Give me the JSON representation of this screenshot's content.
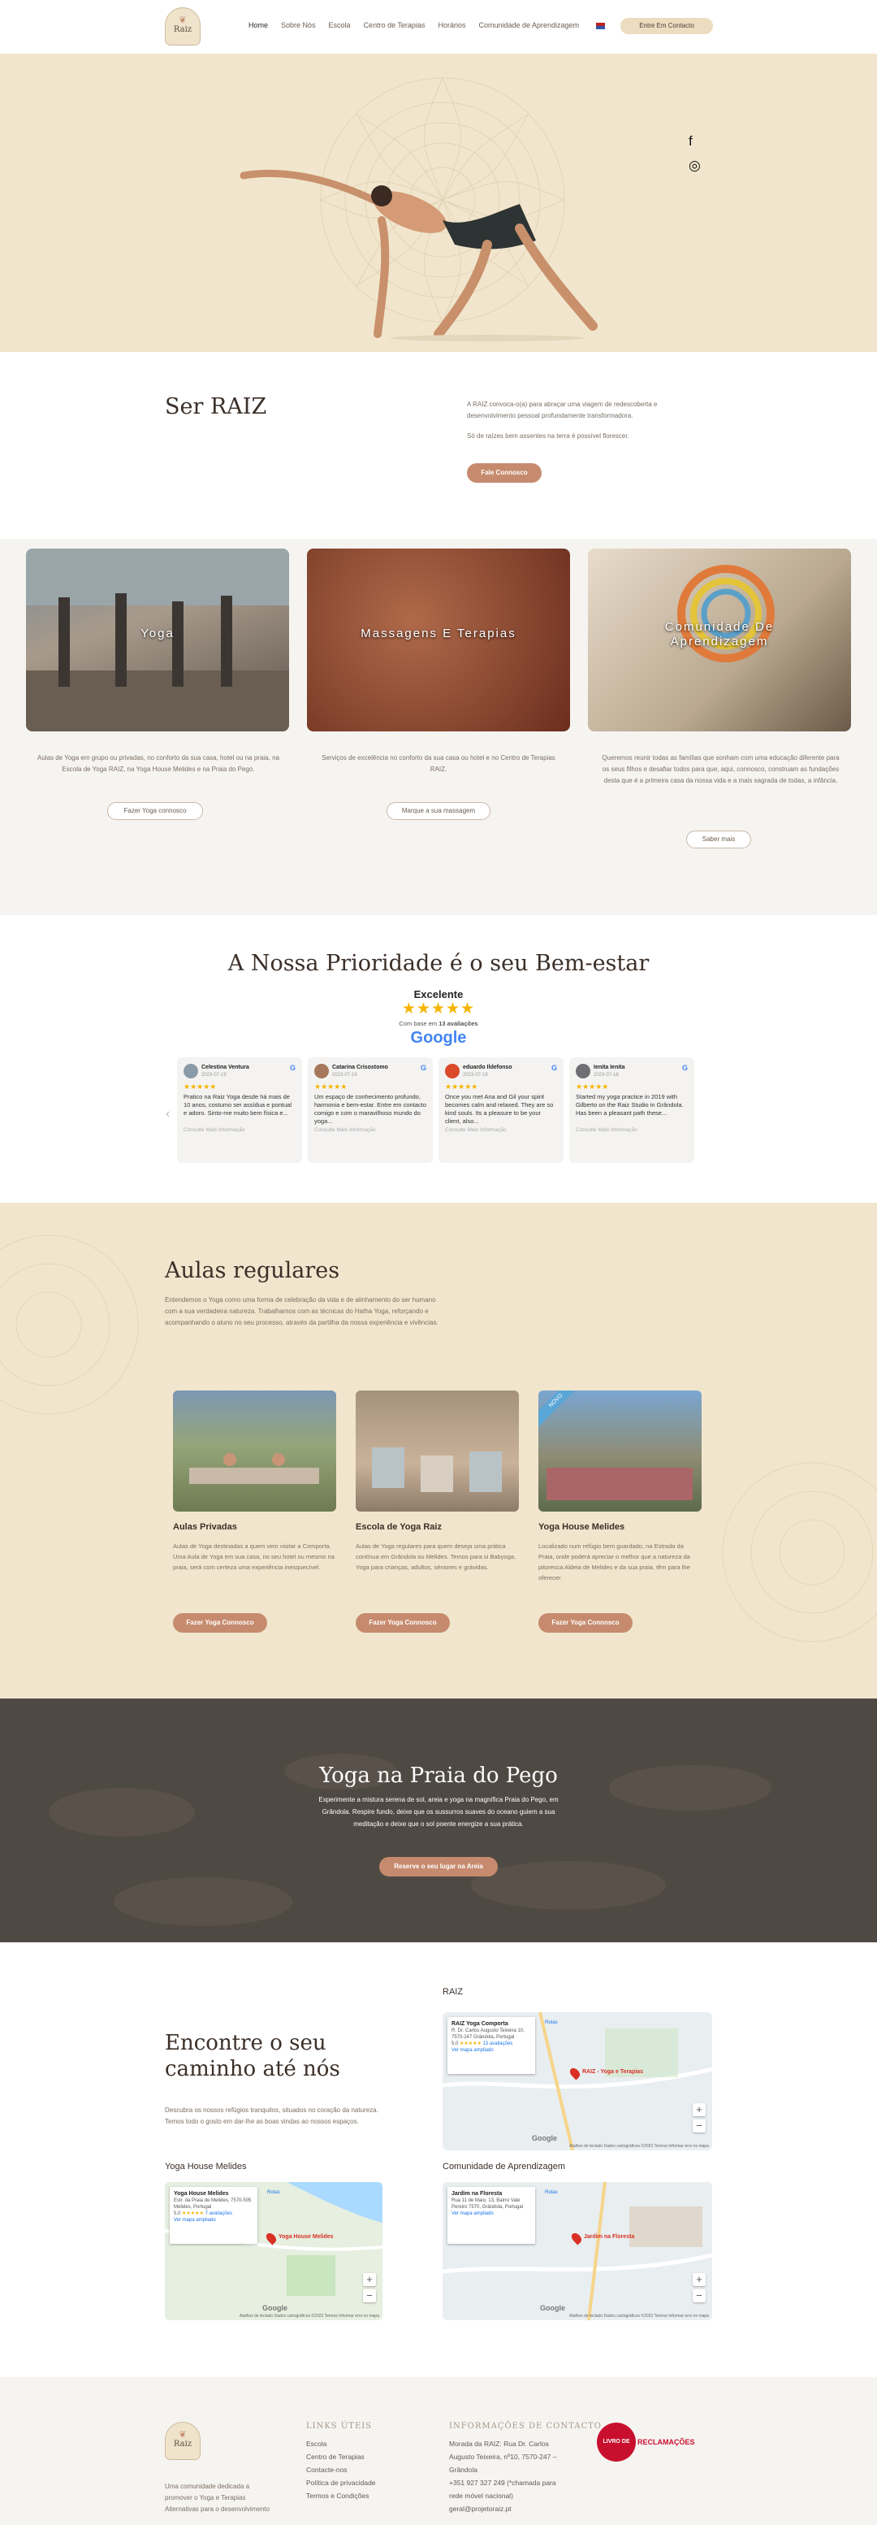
{
  "header": {
    "logo_text": "Raiz",
    "nav": [
      "Home",
      "Sobre Nós",
      "Escola",
      "Centro de Terapias",
      "Horários",
      "Comunidade de Aprendizagem"
    ],
    "cta": "Entre Em Contacto"
  },
  "hero": {
    "icons": [
      "facebook-icon",
      "instagram-icon"
    ]
  },
  "ser_raiz": {
    "title": "Ser RAIZ",
    "p1": "A RAIZ convoca-o(a) para abraçar uma viagem de redescoberta e desenvolvimento pessoal profundamente transformadora.",
    "p2": "Só de raízes bem assentes na terra é possível florescer.",
    "button": "Fale Connosco"
  },
  "cards": [
    {
      "title": "Yoga",
      "desc": "Aulas de Yoga em grupo ou privadas, no conforto da sua casa, hotel ou na praia, na Escola de Yoga RAIZ, na Yoga House Melides e na Praia do Pego.",
      "button": "Fazer Yoga connosco"
    },
    {
      "title": "Massagens E Terapias",
      "desc": "Serviços de excelência no conforto da sua casa ou hotel e no Centro de Terapias RAIZ.",
      "button": "Marque a sua massagem"
    },
    {
      "title": "Comunidade De Aprendizagem",
      "desc": "Queremos reunir todas as famílias que sonham com uma educação diferente para os seus filhos e desafiar todos para que, aqui, connosco, construam as fundações desta que é a primeira casa da nossa vida e a mais sagrada de todas, a infância.",
      "button": "Saber mais"
    }
  ],
  "reviews": {
    "title": "A Nossa Prioridade é o seu Bem-estar",
    "rating_label": "Excelente",
    "stars": "★★★★★",
    "based_on": "Com base em",
    "count": "13 avaliações",
    "google": "Google",
    "more_label": "Consulte Mais Informação",
    "items": [
      {
        "name": "Celestina Ventura",
        "date": "2023-07-19",
        "text": "Pratico na Raiz Yoga desde há mais de 10 anos, costumo ser assídua e pontual e adoro. Sinto-me muito bem física e...",
        "color": "#8a9ba8"
      },
      {
        "name": "Catarina Crisostomo",
        "date": "2023-07-19",
        "text": "Um espaço de conhecimento profundo, harmonia e bem-estar. Entre em contacto comigo e com o maravilhoso mundo do yoga...",
        "color": "#a5785c"
      },
      {
        "name": "eduardo Ildefonso",
        "date": "2023-07-18",
        "text": "Once you met Ana and Gil your spirit becomes calm and relaxed. They are so kind souls. Its a pleasure to be your client, also...",
        "color": "#d9492a"
      },
      {
        "name": "Ienita Ienita",
        "date": "2023-07-18",
        "text": "Started my yoga practice in 2019 with Gilberto on the Raiz Studio in Grândola. Has been a pleasant path these...",
        "color": "#6d6f73"
      }
    ]
  },
  "aulas": {
    "title": "Aulas regulares",
    "intro": "Entendemos o Yoga como uma forma de celebração da vida e de alinhamento do ser humano com a sua verdadeira natureza. Trabalhamos com as técnicas do Hatha Yoga, reforçando e acompanhando o aluno no seu processo, através da partilha da nossa experiência e vivências.",
    "badge": "NOVO",
    "items": [
      {
        "title": "Aulas Privadas",
        "desc": "Aulas de Yoga destinadas a quem vem visitar a Comporta. Uma Aula de Yoga em sua casa, no seu hotel ou mesmo na praia, será com certeza uma experiência inesquecível.",
        "button": "Fazer Yoga Connosco"
      },
      {
        "title": "Escola de Yoga Raiz",
        "desc": "Aulas de Yoga regulares para quem deseja uma prática contínua em Grândola ou Melides. Temos para si Babyoga, Yoga para crianças, adultos, séniores e grávidas.",
        "button": "Fazer Yoga Connosco"
      },
      {
        "title": "Yoga House Melides",
        "desc": "Localizado num refúgio bem guardado, na Estrada da Praia, onde poderá apreciar o melhor que a natureza da pitoresca Aldeia de Melides e da sua praia, têm para lhe oferecer.",
        "button": "Fazer Yoga Connosco"
      }
    ]
  },
  "praia": {
    "title": "Yoga na Praia do Pego",
    "desc": "Experimente a mistura serena de sol, areia e yoga na magnífica Praia do Pego, em Grândola. Respire fundo, deixe que os sussurros suaves do oceano guiem a sua meditação e deixe que o sol poente energize a sua prática.",
    "button": "Reserve o seu lugar na Areia"
  },
  "maps": {
    "title": "Encontre o seu caminho até nós",
    "desc": "Descubra os nossos refúgios tranquilos, situados no coração da natureza. Temos todo o gosto em dar-lhe as boas vindas ao nossos espaços.",
    "items": [
      {
        "label": "RAIZ",
        "place": "RAIZ Yoga Comporta",
        "addr": "R. Dr. Carlos Augusto Teixeira 10, 7570-247 Grândola, Portugal",
        "rating": "5,0",
        "stars": "★★★★★",
        "reviews": "13 avaliações",
        "link": "Ver mapa ampliado",
        "pin": "RAIZ - Yoga e Terapias",
        "route": "Rotas"
      },
      {
        "label": "Yoga House Melides",
        "place": "Yoga House Melides",
        "addr": "Estr. da Praia de Melides, 7570-505 Melides, Portugal",
        "rating": "5,0",
        "stars": "★★★★★",
        "reviews": "7 avaliações",
        "link": "Ver mapa ampliado",
        "pin": "Yoga House Melides",
        "route": "Rotas"
      },
      {
        "label": "Comunidade de Aprendizagem",
        "place": "Jardim na Floresta",
        "addr": "Rua 11 de Maio, 13, Bairro Vale Pereiro 7570, Grândola, Portugal",
        "rating": "",
        "stars": "",
        "reviews": "",
        "link": "Ver mapa ampliado",
        "pin": "Jardim na Floresta",
        "route": "Rotas"
      }
    ],
    "google": "Google",
    "map_footer": "Atalhos de teclado   Dados cartográficos ©2023   Termos   Informar erro no mapa"
  },
  "footer": {
    "tagline": "Uma comunidade dedicada a promover o Yoga e Terapias Alternativas para o desenvolvimento",
    "links_title": "LINKS ÚTEIS",
    "links": [
      "Escola",
      "Centro de Terapias",
      "Contacte-nos",
      "Política de privacidade",
      "Termos e Condições"
    ],
    "info_title": "INFORMAÇÕES DE CONTACTO",
    "info": [
      "Morada da RAIZ: Rua Dr. Carlos",
      "Augusto Teixeira, nº10, 7570-247 –",
      "Grândola",
      "+351 927 327 249 (*chamada para",
      "rede móvel nacional)",
      "geral@projetoraiz.pt"
    ],
    "complaints_a": "LIVRO DE",
    "complaints_b": "RECLAMAÇÕES"
  }
}
